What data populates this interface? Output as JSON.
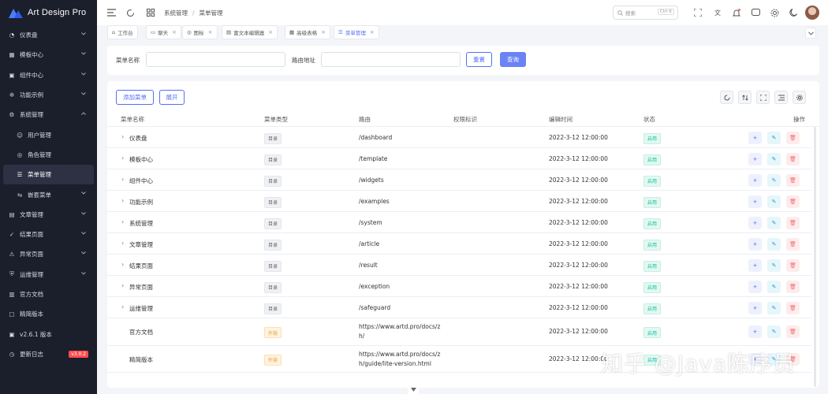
{
  "app": {
    "title": "Art Design Pro"
  },
  "sidebar": {
    "items": [
      {
        "label": "仪表盘",
        "icon": "dashboard-icon",
        "chevron": true
      },
      {
        "label": "模板中心",
        "icon": "template-icon",
        "chevron": true
      },
      {
        "label": "组件中心",
        "icon": "components-icon",
        "chevron": true
      },
      {
        "label": "功能示例",
        "icon": "examples-icon",
        "chevron": true
      },
      {
        "label": "系统管理",
        "icon": "system-icon",
        "chevron": true,
        "open": true
      },
      {
        "label": "用户管理",
        "icon": "user-icon",
        "sub": true
      },
      {
        "label": "角色管理",
        "icon": "role-icon",
        "sub": true
      },
      {
        "label": "菜单管理",
        "icon": "menu-icon",
        "sub": true,
        "active": true
      },
      {
        "label": "嵌套菜单",
        "icon": "nested-icon",
        "sub": true,
        "chevron": true
      },
      {
        "label": "文章管理",
        "icon": "article-icon",
        "chevron": true
      },
      {
        "label": "结果页面",
        "icon": "result-icon",
        "chevron": true
      },
      {
        "label": "异常页面",
        "icon": "exception-icon",
        "chevron": true
      },
      {
        "label": "运维管理",
        "icon": "safeguard-icon",
        "chevron": true
      },
      {
        "label": "官方文档",
        "icon": "docs-icon"
      },
      {
        "label": "精简版本",
        "icon": "lite-icon"
      },
      {
        "label": "v2.6.1 版本",
        "icon": "version-icon"
      },
      {
        "label": "更新日志",
        "icon": "changelog-icon",
        "badge": "v3.0.2"
      }
    ]
  },
  "topbar": {
    "breadcrumb": [
      "系统管理",
      "菜单管理"
    ],
    "breadcrumb_sep": "/",
    "search_placeholder": "搜索",
    "search_shortcut": "Ctrl K"
  },
  "tabs": [
    {
      "label": "工作台",
      "icon": "home-icon",
      "closable": false
    },
    {
      "label": "聊天",
      "icon": "chat-icon",
      "closable": true
    },
    {
      "label": "图标",
      "icon": "icon-icon",
      "closable": true
    },
    {
      "label": "富文本编辑器",
      "icon": "editor-icon",
      "closable": true
    },
    {
      "label": "高级表格",
      "icon": "table-icon",
      "closable": true
    },
    {
      "label": "菜单管理",
      "icon": "menu-icon",
      "closable": true,
      "active": true
    }
  ],
  "filter": {
    "menu_name_label": "菜单名称",
    "menu_name_value": "",
    "route_label": "路由地址",
    "route_value": "",
    "reset_label": "重置",
    "query_label": "查询"
  },
  "table": {
    "add_label": "添加菜单",
    "expand_label": "展开",
    "columns": [
      "菜单名称",
      "菜单类型",
      "路由",
      "权限标识",
      "编辑时间",
      "状态",
      "操作"
    ],
    "rows": [
      {
        "name": "仪表盘",
        "type": "目录",
        "type_kind": "dir",
        "route": "/dashboard",
        "perm": "",
        "time": "2022-3-12 12:00:00",
        "status": "启用",
        "expandable": true
      },
      {
        "name": "模板中心",
        "type": "目录",
        "type_kind": "dir",
        "route": "/template",
        "perm": "",
        "time": "2022-3-12 12:00:00",
        "status": "启用",
        "expandable": true
      },
      {
        "name": "组件中心",
        "type": "目录",
        "type_kind": "dir",
        "route": "/widgets",
        "perm": "",
        "time": "2022-3-12 12:00:00",
        "status": "启用",
        "expandable": true
      },
      {
        "name": "功能示例",
        "type": "目录",
        "type_kind": "dir",
        "route": "/examples",
        "perm": "",
        "time": "2022-3-12 12:00:00",
        "status": "启用",
        "expandable": true
      },
      {
        "name": "系统管理",
        "type": "目录",
        "type_kind": "dir",
        "route": "/system",
        "perm": "",
        "time": "2022-3-12 12:00:00",
        "status": "启用",
        "expandable": true
      },
      {
        "name": "文章管理",
        "type": "目录",
        "type_kind": "dir",
        "route": "/article",
        "perm": "",
        "time": "2022-3-12 12:00:00",
        "status": "启用",
        "expandable": true
      },
      {
        "name": "结果页面",
        "type": "目录",
        "type_kind": "dir",
        "route": "/result",
        "perm": "",
        "time": "2022-3-12 12:00:00",
        "status": "启用",
        "expandable": true
      },
      {
        "name": "异常页面",
        "type": "目录",
        "type_kind": "dir",
        "route": "/exception",
        "perm": "",
        "time": "2022-3-12 12:00:00",
        "status": "启用",
        "expandable": true
      },
      {
        "name": "运维管理",
        "type": "目录",
        "type_kind": "dir",
        "route": "/safeguard",
        "perm": "",
        "time": "2022-3-12 12:00:00",
        "status": "启用",
        "expandable": true
      },
      {
        "name": "官方文档",
        "type": "外链",
        "type_kind": "ext",
        "route_lines": [
          "https://www.artd.pro/docs/z",
          "h/"
        ],
        "perm": "",
        "time": "2022-3-12 12:00:00",
        "status": "启用",
        "expandable": false
      },
      {
        "name": "精简版本",
        "type": "外链",
        "type_kind": "ext",
        "route_lines": [
          "https://www.artd.pro/docs/z",
          "h/guide/lite-version.html"
        ],
        "perm": "",
        "time": "2022-3-12 12:00:00",
        "status": "启用",
        "expandable": false
      }
    ],
    "action_add": "+",
    "action_edit": "✎",
    "action_delete": "🗑"
  },
  "watermark": "知乎 @Java陈序员",
  "colors": {
    "primary": "#5470f5",
    "sidebar_bg": "#1b1e2b",
    "success": "#13c2a3",
    "warning": "#e6a23c",
    "danger": "#f56c6c"
  }
}
